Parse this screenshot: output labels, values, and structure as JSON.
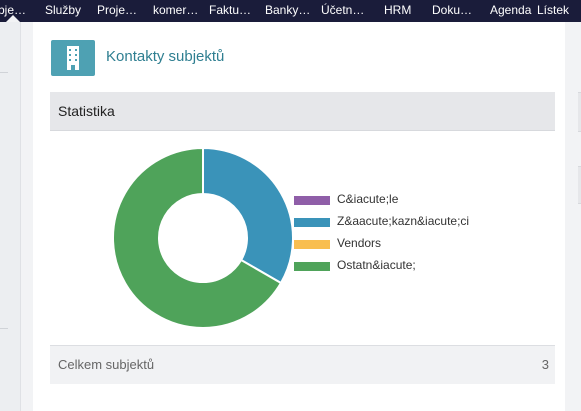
{
  "nav": {
    "items": [
      "bje…",
      "Služby",
      "Proje…",
      "komer…",
      "Faktu…",
      "Banky…",
      "Účetn…",
      "HRM",
      "Doku…",
      "Agenda",
      "Lístek"
    ]
  },
  "panel": {
    "title": "Kontakty subjektů",
    "icon": "building-icon",
    "stats": {
      "title": "Statistika",
      "total_label": "Celkem subjektů",
      "total_value": "3"
    }
  },
  "colors": {
    "nav_bg": "#1a1c3a",
    "accent": "#2f7f91",
    "icon_bg": "#4ea1b3"
  },
  "chart_data": {
    "type": "pie",
    "donut": true,
    "categories": [
      "C&iacute;le",
      "Z&aacute;kazn&iacute;ci",
      "Vendors",
      "Ostatn&iacute;"
    ],
    "values": [
      0,
      1,
      0,
      2
    ],
    "colors": [
      "#8f5ea8",
      "#3a93b9",
      "#f9be4f",
      "#4fa35a"
    ],
    "legend_position": "right"
  }
}
